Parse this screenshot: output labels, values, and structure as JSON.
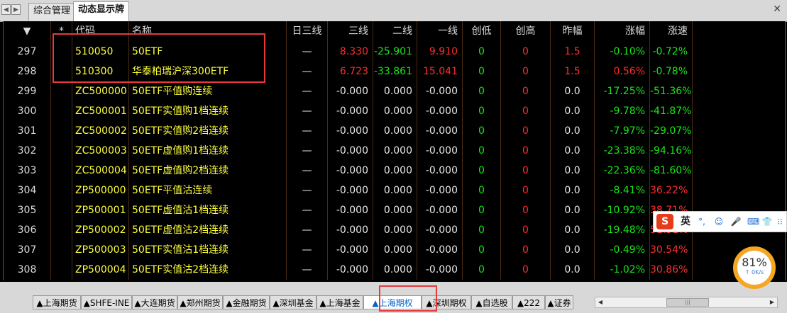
{
  "top_tabs": [
    "综合管理",
    "动态显示牌"
  ],
  "top_nav": [
    "◀",
    "▶"
  ],
  "close_glyph": "✕",
  "headers": [
    "▼",
    "*",
    "代码",
    "名称",
    "日三线",
    "三线",
    "二线",
    "一线",
    "创低",
    "创高",
    "昨幅",
    "涨幅",
    "涨速"
  ],
  "rows": [
    {
      "idx": "297",
      "code": "510050",
      "name": "50ETF",
      "dash": "—",
      "v1": "8.330",
      "v2": "-25.901",
      "v3": "9.910",
      "low": "0",
      "high": "0",
      "prev": "1.5",
      "chg": "-0.10%",
      "spd": "-0.72%"
    },
    {
      "idx": "298",
      "code": "510300",
      "name": "华泰柏瑞沪深300ETF",
      "dash": "—",
      "v1": "6.723",
      "v2": "-33.861",
      "v3": "15.041",
      "low": "0",
      "high": "0",
      "prev": "1.5",
      "chg": "0.56%",
      "spd": "-0.78%"
    },
    {
      "idx": "299",
      "code": "ZC500000",
      "name": "50ETF平值购连续",
      "dash": "—",
      "v1": "-0.000",
      "v2": "0.000",
      "v3": "-0.000",
      "low": "0",
      "high": "0",
      "prev": "0.0",
      "chg": "-17.25%",
      "spd": "-51.36%"
    },
    {
      "idx": "300",
      "code": "ZC500001",
      "name": "50ETF实值购1档连续",
      "dash": "—",
      "v1": "-0.000",
      "v2": "0.000",
      "v3": "-0.000",
      "low": "0",
      "high": "0",
      "prev": "0.0",
      "chg": "-9.78%",
      "spd": "-41.87%"
    },
    {
      "idx": "301",
      "code": "ZC500002",
      "name": "50ETF实值购2档连续",
      "dash": "—",
      "v1": "-0.000",
      "v2": "0.000",
      "v3": "-0.000",
      "low": "0",
      "high": "0",
      "prev": "0.0",
      "chg": "-7.97%",
      "spd": "-29.07%"
    },
    {
      "idx": "302",
      "code": "ZC500003",
      "name": "50ETF虚值购1档连续",
      "dash": "—",
      "v1": "-0.000",
      "v2": "0.000",
      "v3": "-0.000",
      "low": "0",
      "high": "0",
      "prev": "0.0",
      "chg": "-23.38%",
      "spd": "-94.16%"
    },
    {
      "idx": "303",
      "code": "ZC500004",
      "name": "50ETF虚值购2档连续",
      "dash": "—",
      "v1": "-0.000",
      "v2": "0.000",
      "v3": "-0.000",
      "low": "0",
      "high": "0",
      "prev": "0.0",
      "chg": "-22.36%",
      "spd": "-81.60%"
    },
    {
      "idx": "304",
      "code": "ZP500000",
      "name": "50ETF平值沽连续",
      "dash": "—",
      "v1": "-0.000",
      "v2": "0.000",
      "v3": "-0.000",
      "low": "0",
      "high": "0",
      "prev": "0.0",
      "chg": "-8.41%",
      "spd": "36.22%"
    },
    {
      "idx": "305",
      "code": "ZP500001",
      "name": "50ETF虚值沽1档连续",
      "dash": "—",
      "v1": "-0.000",
      "v2": "0.000",
      "v3": "-0.000",
      "low": "0",
      "high": "0",
      "prev": "0.0",
      "chg": "-10.92%",
      "spd": "38.71%"
    },
    {
      "idx": "306",
      "code": "ZP500002",
      "name": "50ETF虚值沽2档连续",
      "dash": "—",
      "v1": "-0.000",
      "v2": "0.000",
      "v3": "-0.000",
      "low": "0",
      "high": "0",
      "prev": "0.0",
      "chg": "-19.48%",
      "spd": "51.51%"
    },
    {
      "idx": "307",
      "code": "ZP500003",
      "name": "50ETF实值沽1档连续",
      "dash": "—",
      "v1": "-0.000",
      "v2": "0.000",
      "v3": "-0.000",
      "low": "0",
      "high": "0",
      "prev": "0.0",
      "chg": "-0.49%",
      "spd": "30.54%"
    },
    {
      "idx": "308",
      "code": "ZP500004",
      "name": "50ETF实值沽2档连续",
      "dash": "—",
      "v1": "-0.000",
      "v2": "0.000",
      "v3": "-0.000",
      "low": "0",
      "high": "0",
      "prev": "0.0",
      "chg": "-1.02%",
      "spd": "30.86%"
    }
  ],
  "row_colors": [
    {
      "v1": "red",
      "v2": "green",
      "v3": "red",
      "chg": "green",
      "spd": "green"
    },
    {
      "v1": "red",
      "v2": "green",
      "v3": "red",
      "chg": "red",
      "spd": "green"
    },
    {
      "v1": "white",
      "v2": "white",
      "v3": "white",
      "chg": "green",
      "spd": "green"
    },
    {
      "v1": "white",
      "v2": "white",
      "v3": "white",
      "chg": "green",
      "spd": "green"
    },
    {
      "v1": "white",
      "v2": "white",
      "v3": "white",
      "chg": "green",
      "spd": "green"
    },
    {
      "v1": "white",
      "v2": "white",
      "v3": "white",
      "chg": "green",
      "spd": "green"
    },
    {
      "v1": "white",
      "v2": "white",
      "v3": "white",
      "chg": "green",
      "spd": "green"
    },
    {
      "v1": "white",
      "v2": "white",
      "v3": "white",
      "chg": "green",
      "spd": "red"
    },
    {
      "v1": "white",
      "v2": "white",
      "v3": "white",
      "chg": "green",
      "spd": "red"
    },
    {
      "v1": "white",
      "v2": "white",
      "v3": "white",
      "chg": "green",
      "spd": "red"
    },
    {
      "v1": "white",
      "v2": "white",
      "v3": "white",
      "chg": "green",
      "spd": "red"
    },
    {
      "v1": "white",
      "v2": "white",
      "v3": "white",
      "chg": "green",
      "spd": "red"
    }
  ],
  "bottom_tabs": [
    "▲上海期货",
    "▲SHFE-INE",
    "▲大连期货",
    "▲郑州期货",
    "▲金融期货",
    "▲深圳基金",
    "▲上海基金",
    "▲上海期权",
    "▲深圳期权",
    "▲自选股",
    "▲222",
    "▲证券"
  ],
  "active_bottom_tab": 7,
  "ime": {
    "logo": "S",
    "lang": "英",
    "icons": [
      "°,",
      "☺",
      "🎤",
      "⌨",
      "👕",
      "⁝⁝"
    ]
  },
  "speed_widget": {
    "percent": "81%",
    "rate": "↑ 0K/s"
  },
  "colors": {
    "code_yellow": "#ffff3b",
    "up_red": "#ff2d2d",
    "down_green": "#19e619",
    "grid_line": "#4a2c14",
    "highlight_box": "#e5393e",
    "active_tab_text": "#0064c8"
  }
}
